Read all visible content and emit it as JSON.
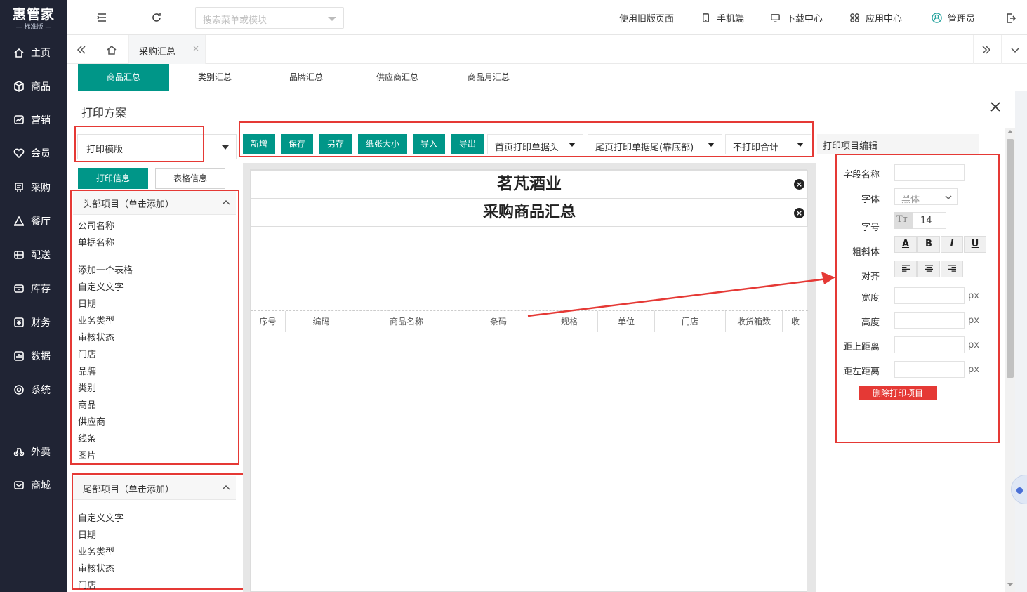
{
  "brand": {
    "name": "惠管家",
    "edition": "标准版"
  },
  "sidebar": {
    "items": [
      {
        "label": "主页",
        "icon": "home-icon"
      },
      {
        "label": "商品",
        "icon": "box-icon"
      },
      {
        "label": "营销",
        "icon": "chart-icon"
      },
      {
        "label": "会员",
        "icon": "heart-icon"
      },
      {
        "label": "采购",
        "icon": "cart-icon"
      },
      {
        "label": "餐厅",
        "icon": "triangle-icon"
      },
      {
        "label": "配送",
        "icon": "truck-icon"
      },
      {
        "label": "库存",
        "icon": "inventory-icon"
      },
      {
        "label": "财务",
        "icon": "finance-icon"
      },
      {
        "label": "数据",
        "icon": "data-icon"
      },
      {
        "label": "系统",
        "icon": "settings-icon"
      },
      {
        "label": "外卖",
        "icon": "delivery-icon"
      },
      {
        "label": "商城",
        "icon": "store-icon"
      }
    ]
  },
  "topbar": {
    "search_placeholder": "搜索菜单或模块",
    "links": [
      {
        "label": "使用旧版页面",
        "icon": ""
      },
      {
        "label": "手机端",
        "icon": "mobile-icon"
      },
      {
        "label": "下载中心",
        "icon": "monitor-icon"
      },
      {
        "label": "应用中心",
        "icon": "apps-icon"
      },
      {
        "label": "管理员",
        "icon": "user-icon"
      }
    ]
  },
  "tabbar": {
    "active_tab": "采购汇总",
    "close_symbol": "×"
  },
  "subtabs": [
    "商品汇总",
    "类别汇总",
    "品牌汇总",
    "供应商汇总",
    "商品月汇总"
  ],
  "modal": {
    "title": "打印方案",
    "template_select": "打印模版",
    "info_tabs": {
      "print_info": "打印信息",
      "table_info": "表格信息"
    },
    "header_panel": {
      "title": "头部项目（单击添加）",
      "items_a": [
        "公司名称",
        "单据名称"
      ],
      "items_b": [
        "添加一个表格",
        "自定义文字",
        "日期",
        "业务类型",
        "审核状态",
        "门店",
        "品牌",
        "类别",
        "商品",
        "供应商",
        "线条",
        "图片"
      ]
    },
    "footer_panel": {
      "title": "尾部项目（单击添加）",
      "items": [
        "自定义文字",
        "日期",
        "业务类型",
        "审核状态",
        "门店"
      ]
    },
    "toolbar": {
      "buttons": [
        "新增",
        "保存",
        "另存",
        "纸张大小",
        "导入",
        "导出"
      ],
      "dropdowns": [
        "首页打印单据头",
        "尾页打印单据尾(靠底部)",
        "不打印合计"
      ]
    },
    "canvas": {
      "company_title": "茗芃酒业",
      "document_title": "采购商品汇总",
      "columns": [
        "序号",
        "编码",
        "商品名称",
        "条码",
        "规格",
        "单位",
        "门店",
        "收货箱数",
        "收"
      ]
    },
    "editor": {
      "title": "打印项目编辑",
      "labels": {
        "field_name": "字段名称",
        "font": "字体",
        "font_size": "字号",
        "style": "粗斜体",
        "align": "对齐",
        "width": "宽度",
        "height": "高度",
        "top": "距上距离",
        "left": "距左距离"
      },
      "font_value": "黑体",
      "font_size_value": "14",
      "font_size_icon": "Tт",
      "style_buttons": [
        "A",
        "B",
        "I",
        "U"
      ],
      "unit": "px",
      "delete_button": "删除打印项目"
    }
  }
}
